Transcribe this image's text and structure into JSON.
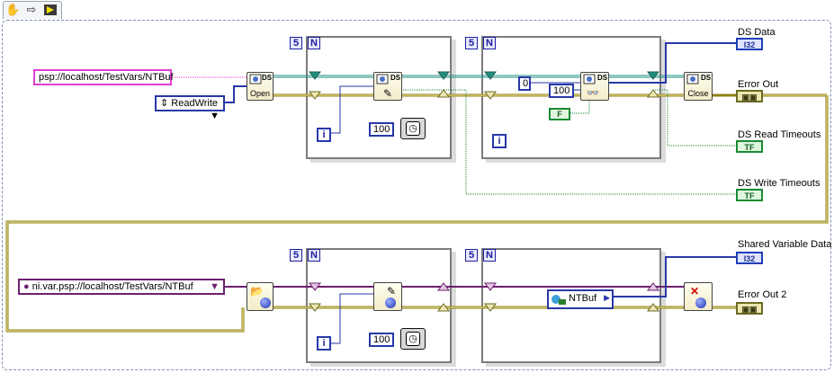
{
  "toolbar": {
    "icons": [
      "hand-icon",
      "arrow-icon",
      "highlight-execution-icon"
    ]
  },
  "controls": {
    "url_string": "psp://localhost/TestVars/NTBuf",
    "access_mode": "ReadWrite",
    "refnum_path": "ni.var.psp://localhost/TestVars/NTBuf"
  },
  "top_loops": {
    "write_loop": {
      "count": "5",
      "n_label": "N",
      "iter_label": "i",
      "wait_ms": "100"
    },
    "read_loop": {
      "count": "5",
      "n_label": "N",
      "iter_label": "i",
      "timeout": "100",
      "offset": "0",
      "bool_const": "F"
    }
  },
  "bottom_loops": {
    "write_loop": {
      "count": "5",
      "n_label": "N",
      "iter_label": "i",
      "wait_ms": "100"
    },
    "read_loop": {
      "count": "5",
      "n_label": "N",
      "variable_name": "NTBuf"
    }
  },
  "nodes": {
    "ds_open": {
      "tag": "DS",
      "label": "Open"
    },
    "ds_write": {
      "tag": "DS"
    },
    "ds_read": {
      "tag": "DS"
    },
    "ds_close": {
      "tag": "DS",
      "label": "Close"
    }
  },
  "indicators": {
    "ds_data": {
      "label": "DS Data",
      "type": "I32"
    },
    "error_out": {
      "label": "Error Out"
    },
    "ds_read_timeouts": {
      "label": "DS Read Timeouts",
      "type": "TF"
    },
    "ds_write_timeouts": {
      "label": "DS Write Timeouts",
      "type": "TF"
    },
    "shared_variable_data": {
      "label": "Shared Variable Data",
      "type": "I32"
    },
    "error_out_2": {
      "label": "Error Out 2"
    }
  },
  "colors": {
    "error_wire": "#8f7f15",
    "refnum_wire": "#1f8f80",
    "string_wire": "#e23ed4",
    "numeric_wire": "#2838a8",
    "boolean_wire": "#1a8a33",
    "path_wire": "#6d1f70"
  }
}
